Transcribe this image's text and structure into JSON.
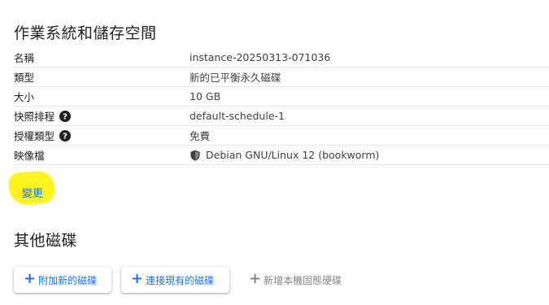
{
  "os_storage": {
    "title": "作業系統和儲存空間",
    "rows": [
      {
        "label": "名稱",
        "value": "instance-20250313-071036"
      },
      {
        "label": "類型",
        "value": "新的已平衡永久磁碟"
      },
      {
        "label": "大小",
        "value": "10 GB"
      },
      {
        "label": "快照排程",
        "value": "default-schedule-1",
        "help_icon": "help-circle-icon"
      },
      {
        "label": "授權類型",
        "value": "免費",
        "help_icon": "help-circle-icon"
      },
      {
        "label": "映像檔",
        "value": "Debian GNU/Linux 12 (bookworm)",
        "value_icon": "shield-icon"
      }
    ],
    "change_label": "變更"
  },
  "other_disks": {
    "title": "其他磁碟",
    "add_new_label": "附加新的磁碟",
    "attach_existing_label": "連接現有的磁碟",
    "add_local_ssd_label": "新增本機固態硬碟"
  },
  "colors": {
    "accent": "#1a73e8",
    "highlight": "#fff200",
    "disabled": "#80868b"
  }
}
